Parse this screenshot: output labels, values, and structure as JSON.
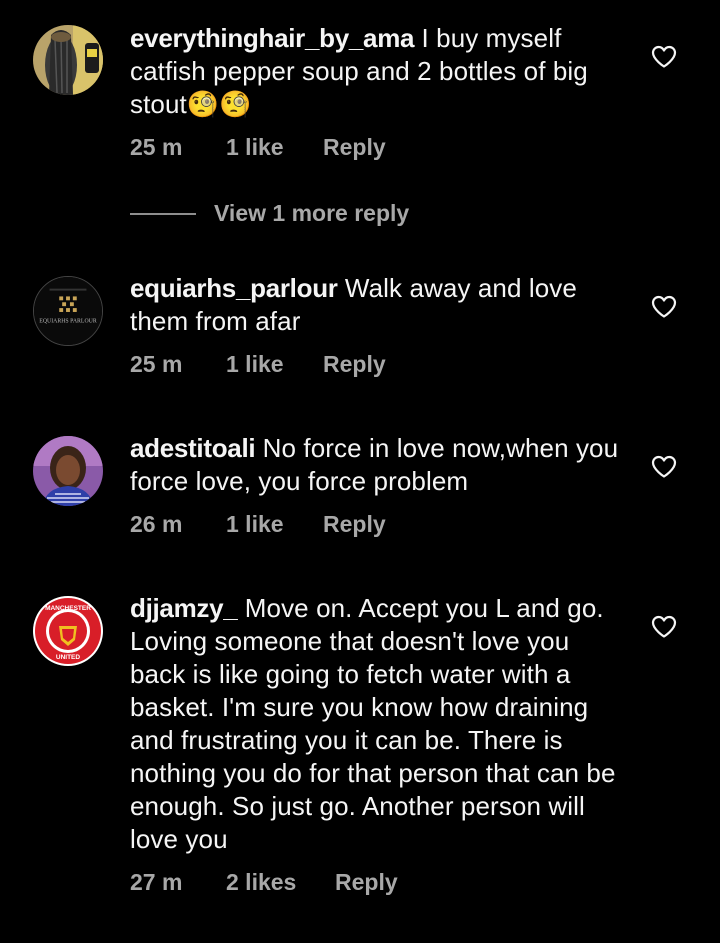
{
  "comments": [
    {
      "username": "everythinghair_by_ama",
      "text": " I buy myself catfish pepper soup and 2 bottles of big stout🧐🧐",
      "time": "25 m",
      "likes": "1 like",
      "reply": "Reply",
      "avatar_icon": "hair-product-avatar"
    },
    {
      "username": "equiarhs_parlour",
      "text": " Walk away and love them from afar",
      "time": "25 m",
      "likes": "1 like",
      "reply": "Reply",
      "avatar_icon": "parlour-logo-avatar",
      "avatar_text": "EQUIARHS PARLOUR"
    },
    {
      "username": "adestitoali",
      "text": " No force in love now,when you force love, you force problem",
      "time": "26 m",
      "likes": "1 like",
      "reply": "Reply",
      "avatar_icon": "person-avatar"
    },
    {
      "username": "djjamzy_",
      "text": " Move on. Accept you L and go. Loving someone that doesn't love you back is like going to fetch water with a basket. I'm sure you know how draining and frustrating you it can be. There is nothing you do for that person that can be enough. So just go. Another person will love you",
      "time": "27 m",
      "likes": "2 likes",
      "reply": "Reply",
      "avatar_icon": "manchester-united-crest-avatar",
      "avatar_text_top": "MANCHESTER",
      "avatar_text_bottom": "UNITED"
    }
  ],
  "view_more_replies": "View 1 more reply",
  "colors": {
    "background": "#000000",
    "text": "#f5f5f5",
    "secondary": "#a8a8a8"
  }
}
